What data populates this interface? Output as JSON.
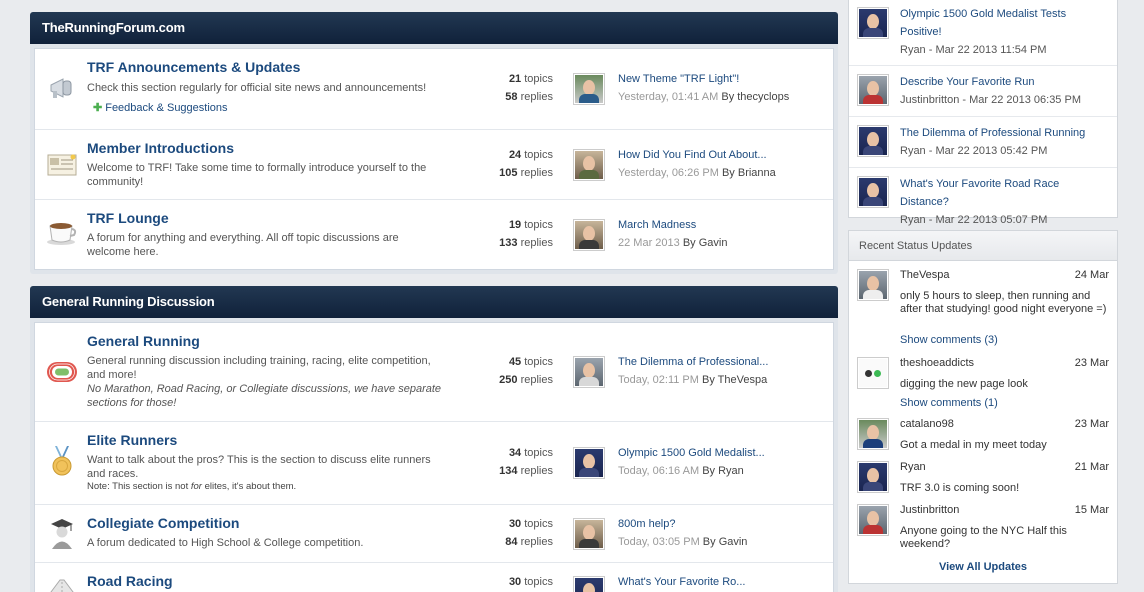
{
  "categories": [
    {
      "title": "TheRunningForum.com",
      "forums": [
        {
          "title": "TRF Announcements & Updates",
          "description": "Check this section regularly for official site news and announcements!",
          "subforum": "Feedback & Suggestions",
          "topics": "21",
          "topics_label": "topics",
          "replies": "58",
          "replies_label": "replies",
          "last_title": "New Theme \"TRF Light\"!",
          "last_time": "Yesterday, 01:41 AM",
          "last_by": "By thecyclops",
          "icon": "megaphone-icon"
        },
        {
          "title": "Member Introductions",
          "description": "Welcome to TRF! Take some time to formally introduce yourself to the community!",
          "topics": "24",
          "topics_label": "topics",
          "replies": "105",
          "replies_label": "replies",
          "last_title": "How Did You Find Out About...",
          "last_time": "Yesterday, 06:26 PM",
          "last_by": "By Brianna",
          "icon": "name-tag-icon"
        },
        {
          "title": "TRF Lounge",
          "description": "A forum for anything and everything. All off topic discussions are welcome here.",
          "topics": "19",
          "topics_label": "topics",
          "replies": "133",
          "replies_label": "replies",
          "last_title": "March Madness",
          "last_time": "22 Mar 2013",
          "last_by": "By Gavin",
          "icon": "coffee-cup-icon"
        }
      ]
    },
    {
      "title": "General Running Discussion",
      "forums": [
        {
          "title": "General Running",
          "description": "General running discussion including training, racing, elite competition, and more!",
          "description_extra": "No Marathon, Road Racing, or Collegiate discussions, we have separate sections for those!",
          "topics": "45",
          "topics_label": "topics",
          "replies": "250",
          "replies_label": "replies",
          "last_title": "The Dilemma of Professional...",
          "last_time": "Today, 02:11 PM",
          "last_by": "By TheVespa",
          "icon": "running-track-icon"
        },
        {
          "title": "Elite Runners",
          "description": "Want to talk about the pros? This is the section to discuss elite runners and races.",
          "note_prefix": "Note: This section is not ",
          "note_em": "for",
          "note_suffix": " elites, it's about them.",
          "topics": "34",
          "topics_label": "topics",
          "replies": "134",
          "replies_label": "replies",
          "last_title": "Olympic 1500 Gold Medalist...",
          "last_time": "Today, 06:16 AM",
          "last_by": "By Ryan",
          "icon": "medal-icon"
        },
        {
          "title": "Collegiate Competition",
          "description": "A forum dedicated to High School & College competition.",
          "topics": "30",
          "topics_label": "topics",
          "replies": "84",
          "replies_label": "replies",
          "last_title": "800m help?",
          "last_time": "Today, 03:05 PM",
          "last_by": "By Gavin",
          "icon": "graduate-icon"
        },
        {
          "title": "Road Racing",
          "topics": "30",
          "topics_label": "topics",
          "last_title": "What's Your Favorite Ro...",
          "icon": "road-icon"
        }
      ]
    }
  ],
  "sidebar": {
    "recent_topics": [
      {
        "title": "Olympic 1500 Gold Medalist Tests Positive!",
        "meta": "Ryan - Mar 22 2013 11:54 PM"
      },
      {
        "title": "Describe Your Favorite Run",
        "meta": "Justinbritton - Mar 22 2013 06:35 PM"
      },
      {
        "title": "The Dilemma of Professional Running",
        "meta": "Ryan - Mar 22 2013 05:42 PM"
      },
      {
        "title": "What's Your Favorite Road Race Distance?",
        "meta": "Ryan - Mar 22 2013 05:07 PM"
      }
    ],
    "status_title": "Recent Status Updates",
    "statuses": [
      {
        "name": "TheVespa",
        "date": "24 Mar",
        "text": "only 5 hours to sleep, then running and after that studying! good night everyone =)",
        "comments": "Show comments (3)"
      },
      {
        "name": "theshoeaddicts",
        "date": "23 Mar",
        "text": "digging the new page look",
        "comments": "Show comments (1)"
      },
      {
        "name": "catalano98",
        "date": "23 Mar",
        "text": "Got a medal in my meet today"
      },
      {
        "name": "Ryan",
        "date": "21 Mar",
        "text": "TRF 3.0 is coming soon!"
      },
      {
        "name": "Justinbritton",
        "date": "15 Mar",
        "text": "Anyone going to the NYC Half this weekend?"
      }
    ],
    "view_all": "View All Updates"
  },
  "colors": {
    "header_bg": "#10213a",
    "link": "#1c4a7e",
    "page_bg": "#e9ebee"
  }
}
